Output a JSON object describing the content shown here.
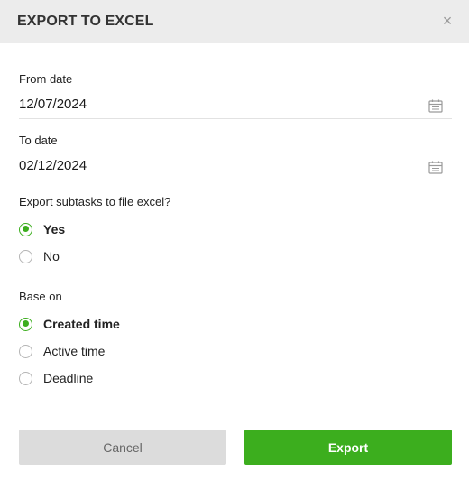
{
  "dialog": {
    "title": "EXPORT TO EXCEL",
    "close_glyph": "×"
  },
  "from_date": {
    "label": "From date",
    "value": "12/07/2024",
    "icon": "calendar-icon"
  },
  "to_date": {
    "label": "To date",
    "value": "02/12/2024",
    "icon": "calendar-icon"
  },
  "subtasks": {
    "question": "Export subtasks to file excel?",
    "options": [
      {
        "label": "Yes",
        "checked": true
      },
      {
        "label": "No",
        "checked": false
      }
    ]
  },
  "base_on": {
    "label": "Base on",
    "options": [
      {
        "label": "Created time",
        "checked": true
      },
      {
        "label": "Active time",
        "checked": false
      },
      {
        "label": "Deadline",
        "checked": false
      }
    ]
  },
  "buttons": {
    "cancel_label": "Cancel",
    "export_label": "Export"
  },
  "colors": {
    "accent": "#3cae1e",
    "header_bg": "#ececec",
    "cancel_bg": "#dcdcdc"
  }
}
